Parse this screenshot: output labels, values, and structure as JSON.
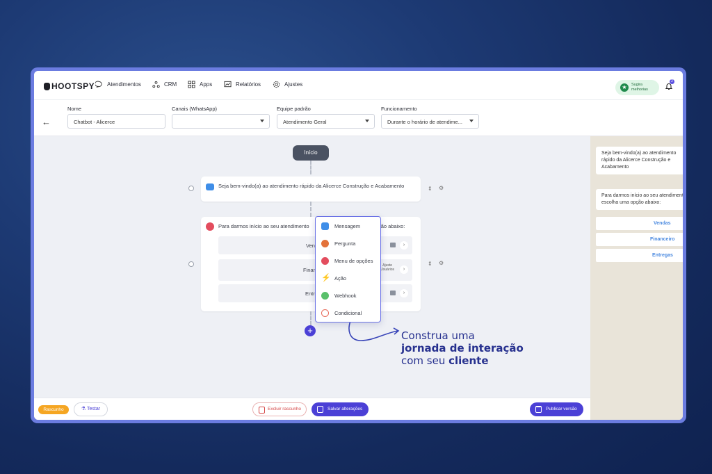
{
  "app": {
    "logo": "HOOTSPY"
  },
  "nav": {
    "items": [
      {
        "label": "Atendimentos",
        "icon": "chat-icon"
      },
      {
        "label": "CRM",
        "icon": "crm-icon"
      },
      {
        "label": "Apps",
        "icon": "apps-grid-icon"
      },
      {
        "label": "Relatórios",
        "icon": "reports-icon"
      },
      {
        "label": "Ajustes",
        "icon": "gear-icon"
      }
    ],
    "suggest_line1": "Sugira",
    "suggest_line2": "melhorias",
    "notifications_count": "2"
  },
  "form": {
    "name_label": "Nome",
    "name_value": "Chatbot - Alicerce",
    "channels_label": "Canais (WhatsApp)",
    "channels_value": "",
    "team_label": "Equipe padrão",
    "team_value": "Atendimento Geral",
    "schedule_label": "Funcionamento",
    "schedule_value": "Durante o horário de atendime..."
  },
  "flow": {
    "start_label": "Início",
    "welcome_text": "Seja bem-vindo(a) ao atendimento rápido da Alicerce Construção e Acabamento",
    "menu_text_left": "Para darmos início ao seu atendimento",
    "menu_text_right": "ção abaixo:",
    "options": [
      {
        "label": "Ven"
      },
      {
        "label": "Finan",
        "adjust_line1": "Ajuste",
        "adjust_line2": "Usuários"
      },
      {
        "label": "Entr"
      }
    ]
  },
  "dropdown": {
    "items": [
      {
        "label": "Mensagem",
        "icon": "message-icon",
        "color": "#3f8ee8"
      },
      {
        "label": "Pergunta",
        "icon": "question-icon",
        "color": "#e3723a"
      },
      {
        "label": "Menu de opções",
        "icon": "menu-options-icon",
        "color": "#e34d5e"
      },
      {
        "label": "Ação",
        "icon": "lightning-icon",
        "color": "#f2c12e"
      },
      {
        "label": "Webhook",
        "icon": "webhook-icon",
        "color": "#5ac06b"
      },
      {
        "label": "Condicional",
        "icon": "conditional-icon",
        "color": "#e86b5a"
      }
    ]
  },
  "promo": {
    "line1": "Construa uma",
    "line2": "jornada de interação",
    "line3_prefix": "com seu ",
    "line3_bold": "cliente"
  },
  "preview": {
    "welcome": "Seja bem-vindo(a) ao atendimento rápido da Alicerce Construção e Acabamento",
    "menu_text": "Para darmos início ao seu atendimento, escolha uma opção abaixo:",
    "options": [
      "Vendas",
      "Financeiro",
      "Entregas"
    ]
  },
  "bottom": {
    "draft_badge": "Rascunho",
    "test_label": "Testar",
    "discard_label": "Excluir rascunho",
    "save_label": "Salvar alterações",
    "publish_label": "Publicar versão"
  },
  "colors": {
    "accent": "#4b40d6",
    "frame": "#6b7ce0",
    "draft": "#f5a623"
  }
}
